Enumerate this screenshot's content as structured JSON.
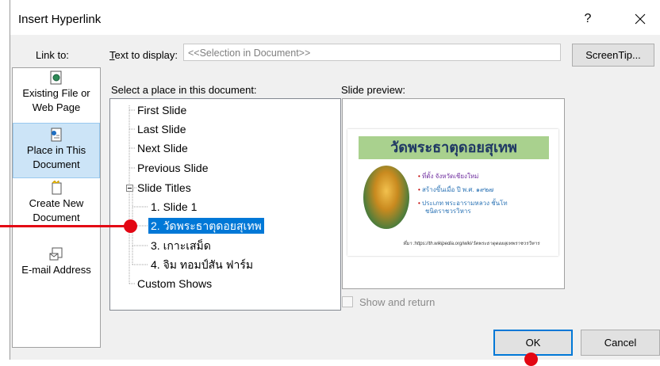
{
  "dialog": {
    "title": "Insert Hyperlink",
    "help_label": "?",
    "close_label": "✕"
  },
  "link_to": {
    "label": "Link to:",
    "items": [
      {
        "line1": "Existing File or",
        "line2": "Web Page"
      },
      {
        "line1": "Place in This",
        "line2": "Document"
      },
      {
        "line1": "Create New",
        "line2": "Document"
      },
      {
        "line1": "E-mail Address",
        "line2": ""
      }
    ]
  },
  "text_to_display": {
    "label": "Text to display:",
    "value": "<<Selection in Document>>"
  },
  "screentip_label": "ScreenTip...",
  "place": {
    "label": "Select a place in this document:",
    "tree": [
      "First Slide",
      "Last Slide",
      "Next Slide",
      "Previous Slide",
      "Slide Titles",
      "1. Slide 1",
      "2. วัดพระธาตุดอยสุเทพ",
      "3. เกาะเสม็ด",
      "4. จิม ทอมป์สัน ฟาร์ม",
      "Custom Shows"
    ],
    "selected_index": 6
  },
  "preview": {
    "label": "Slide preview:",
    "slide_title": "วัดพระธาตุดอยสุเทพ",
    "bullets": [
      "ที่ตั้ง  จังหวัดเชียงใหม่",
      "สร้างขึ้นเมื่อ ปี พ.ศ. ๑๙๒๗",
      "ประเภท พระอารามหลวง ชั้นโท",
      "ชนิดราชวรวิหาร"
    ],
    "source": "ที่มา :https://th.wikipedia.org/wiki/วัดพระธาตุดอยสุเทพราชวรวิหาร"
  },
  "show_and_return": {
    "label": "Show and return",
    "checked": false
  },
  "buttons": {
    "ok": "OK",
    "cancel": "Cancel"
  },
  "colors": {
    "accent": "#0078d7",
    "callout": "#e30613",
    "slide_title_bg": "#a9d18e"
  }
}
